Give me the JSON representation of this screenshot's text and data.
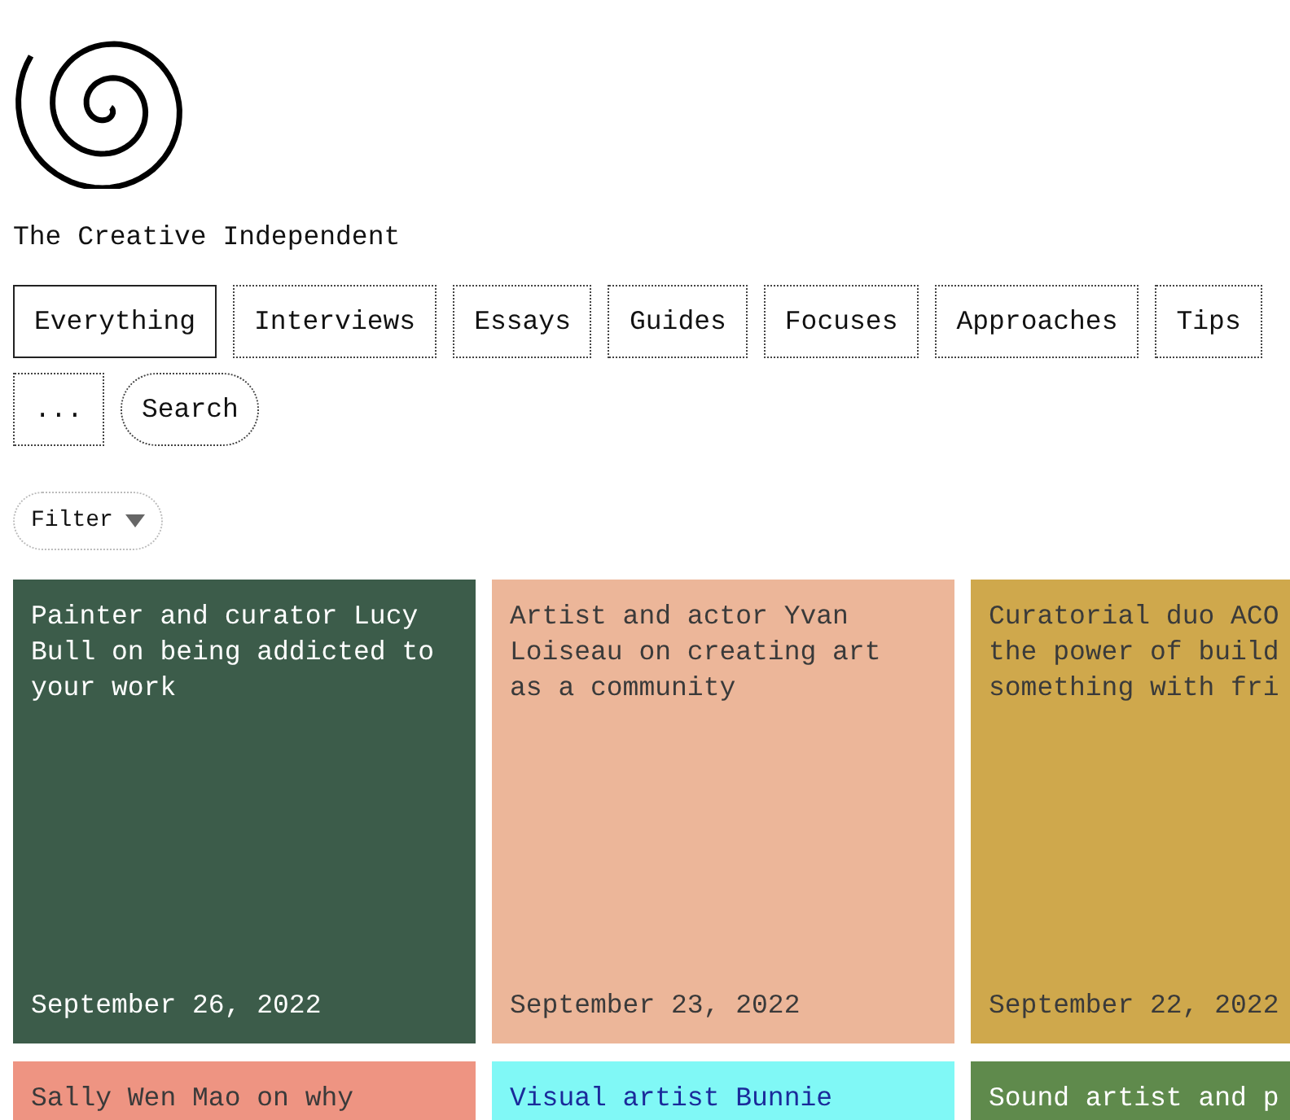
{
  "site_title": "The Creative Independent",
  "tabs": [
    {
      "label": "Everything",
      "selected": true
    },
    {
      "label": "Interviews",
      "selected": false
    },
    {
      "label": "Essays",
      "selected": false
    },
    {
      "label": "Guides",
      "selected": false
    },
    {
      "label": "Focuses",
      "selected": false
    },
    {
      "label": "Approaches",
      "selected": false
    },
    {
      "label": "Tips",
      "selected": false
    }
  ],
  "more_button": "...",
  "search_button": "Search",
  "filter_button": "Filter",
  "cards": [
    {
      "title_lines": [
        "Painter and curator Lucy",
        "Bull on being addicted to",
        "your work"
      ],
      "date": "September 26, 2022",
      "color": "#3c5c4a"
    },
    {
      "title_lines": [
        "Artist and actor Yvan",
        "Loiseau on creating art",
        "as a community"
      ],
      "date": "September 23, 2022",
      "color": "#ecb699"
    },
    {
      "title_lines": [
        "Curatorial duo ACO",
        "the power of build",
        "something with fri"
      ],
      "date": "September 22, 2022",
      "color": "#cfa84c"
    },
    {
      "title_lines": [
        "Sally Wen Mao on why"
      ],
      "color": "#ee9482"
    },
    {
      "title_lines": [
        "Visual artist Bunnie"
      ],
      "color": "#80f8f6"
    },
    {
      "title_lines": [
        "Sound artist and p"
      ],
      "color": "#5f8a4c"
    }
  ]
}
